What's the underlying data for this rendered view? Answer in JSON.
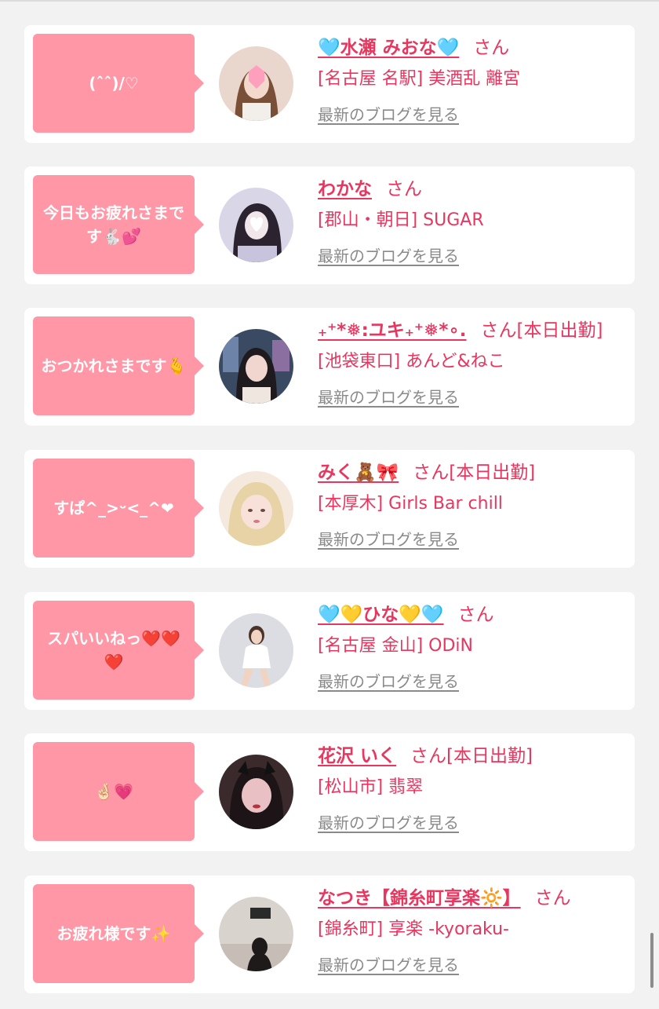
{
  "blog_link_label": "最新のブログを見る",
  "honorific": "さん",
  "colors": {
    "accent": "#e8365f",
    "bubble": "#ff97a6",
    "link_gray": "#8a8a8a",
    "background": "#f2f2f2"
  },
  "entries": [
    {
      "message": "(ˆˆ)/♡",
      "name": "🩵水瀬 みおな🩵",
      "work_tag": "",
      "shop": "[名古屋 名駅] 美酒乱 離宮"
    },
    {
      "message": "今日もお疲れさまです🐇💕",
      "name": "わかな",
      "work_tag": "",
      "shop": "[郡山・朝日] SUGAR"
    },
    {
      "message": "おつかれさまです🫰",
      "name": "₊⁺*❅:ユキ₊⁺❅*∘.",
      "work_tag": "[本日出勤]",
      "shop": "[池袋東口] あんど&ねこ"
    },
    {
      "message": "すぱ^_>ᵕ<_^❤",
      "name": "みく🧸🎀",
      "work_tag": "[本日出勤]",
      "shop": "[本厚木] Girls Bar chill"
    },
    {
      "message": "スパいいねっ❤️❤️❤️",
      "name": "🩵💛ひな💛🩵",
      "work_tag": "",
      "shop": "[名古屋 金山] ODiN"
    },
    {
      "message": "🤞🏻💗",
      "name": "花沢 いく",
      "work_tag": "[本日出勤]",
      "shop": "[松山市] 翡翠"
    },
    {
      "message": "お疲れ様です✨",
      "name": "なつき【錦糸町享楽🔆】",
      "work_tag": "",
      "shop": "[錦糸町] 享楽 -kyoraku-"
    }
  ]
}
